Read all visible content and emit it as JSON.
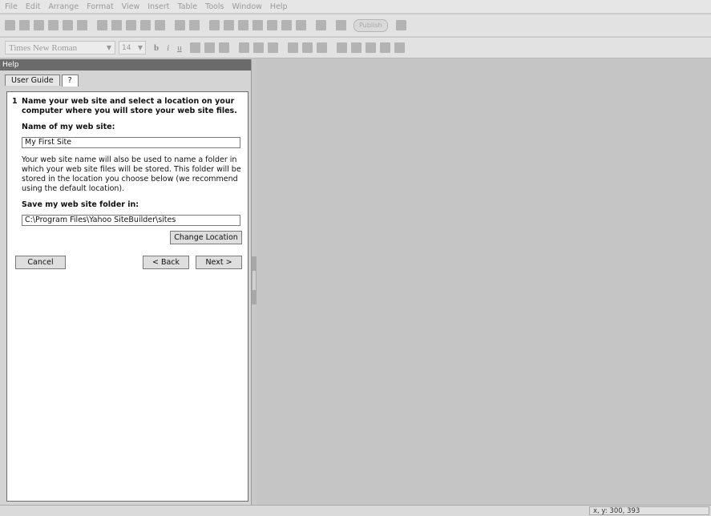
{
  "menu": [
    "File",
    "Edit",
    "Arrange",
    "Format",
    "View",
    "Insert",
    "Table",
    "Tools",
    "Window",
    "Help"
  ],
  "toolbar": {
    "publish_label": "Publish"
  },
  "format_bar": {
    "font": "Times New Roman",
    "size": "14",
    "bold": "b",
    "italic": "i",
    "underline": "u"
  },
  "help": {
    "title": "Help",
    "tabs": [
      "User Guide",
      "?"
    ],
    "step_number": "1",
    "step_text": "Name your web site and select a location on your computer where you will store your web site files.",
    "name_label": "Name of my web site:",
    "name_value": "My First Site",
    "description": "Your web site name will also be used to name a folder in which your web site files will be stored. This folder will be stored in the location you choose below (we recommend using the default location).",
    "folder_label": "Save my web site folder in:",
    "folder_value": "C:\\Program Files\\Yahoo SiteBuilder\\sites",
    "change_location": "Change Location",
    "cancel": "Cancel",
    "back": "< Back",
    "next": "Next >"
  },
  "status": {
    "coords": "x, y: 300, 393"
  }
}
